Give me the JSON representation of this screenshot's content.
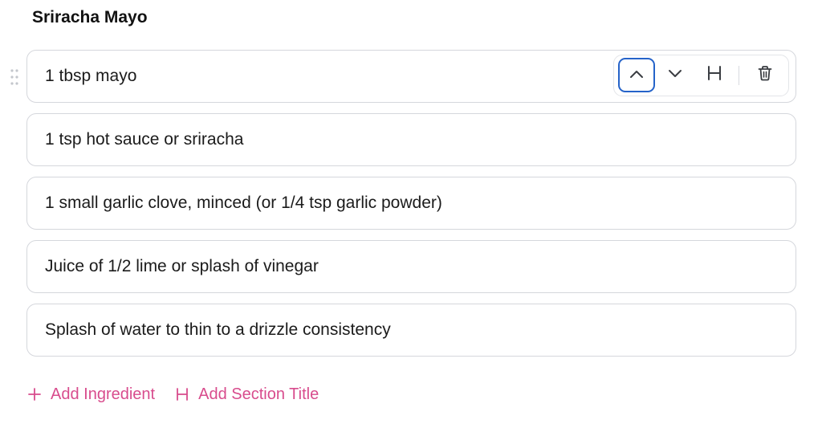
{
  "section": {
    "title": "Sriracha Mayo"
  },
  "ingredients": [
    {
      "text": "1 tbsp mayo"
    },
    {
      "text": "1 tsp hot sauce or sriracha"
    },
    {
      "text": "1 small garlic clove, minced (or 1/4 tsp garlic powder)"
    },
    {
      "text": "Juice of 1/2 lime or splash of vinegar"
    },
    {
      "text": "Splash of water to thin to a drizzle consistency"
    }
  ],
  "toolbar": {
    "move_up_icon": "chevron-up-icon",
    "move_down_icon": "chevron-down-icon",
    "heading_icon": "heading-icon",
    "heading_glyph": "H",
    "delete_icon": "trash-icon",
    "focused_button": "move-up"
  },
  "actions": {
    "add_ingredient_label": "Add Ingredient",
    "add_section_title_label": "Add Section Title",
    "add_ingredient_icon": "plus-icon",
    "add_section_title_icon": "heading-icon",
    "accent_color": "#d84c8d"
  },
  "colors": {
    "focus_ring": "#2563c9",
    "border": "#d5d7dc",
    "text": "#1b1b1b"
  }
}
